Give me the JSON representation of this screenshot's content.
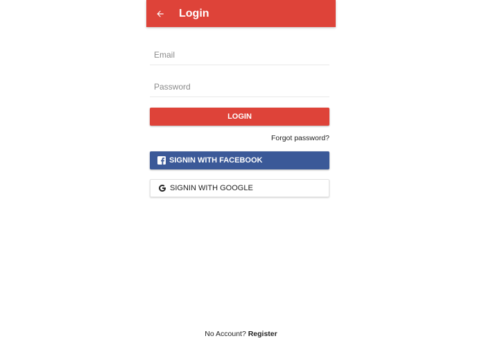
{
  "header": {
    "title": "Login",
    "background": "#de4339",
    "back_icon": "arrow-left-icon"
  },
  "form": {
    "email_placeholder": "Email",
    "password_placeholder": "Password",
    "login_label": "LOGIN",
    "forgot_label": "Forgot password?"
  },
  "social": {
    "facebook_label": "SIGNIN WITH FACEBOOK",
    "facebook_icon": "facebook-icon",
    "facebook_color": "#3b5998",
    "google_label": "SIGNIN WITH GOOGLE",
    "google_icon": "google-icon"
  },
  "footer": {
    "prompt": "No Account?",
    "register_label": "Register"
  }
}
